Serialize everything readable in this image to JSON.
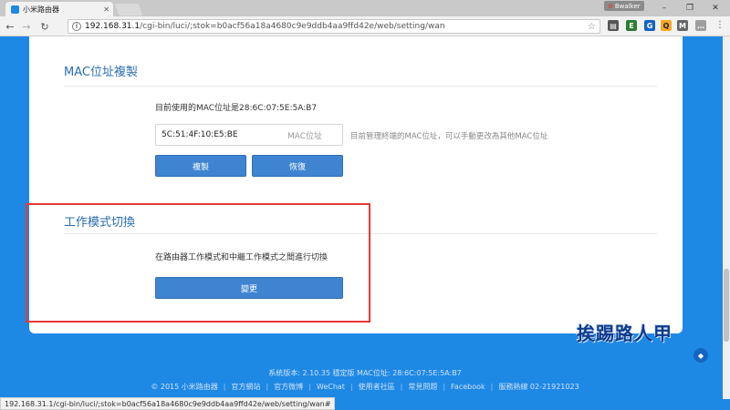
{
  "browser": {
    "tab_title": "小米路由器",
    "profile_badge": "Bwalker",
    "url_host": "192.168.31.1",
    "url_path": "/cgi-bin/luci/;stok=b0acf56a18a4680c9e9ddb4aa9ffd42e/web/setting/wan",
    "status_url": "192.168.31.1/cgi-bin/luci/;stok=b0acf56a18a4680c9e9ddb4aa9ffd42e/web/setting/wan#"
  },
  "mac_section": {
    "title": "MAC位址複製",
    "current_mac_text": "目前使用的MAC位址是28:6C:07:5E:5A:B7",
    "input_value": "5C:51:4F:10:E5:BE",
    "input_placeholder": "MAC位址",
    "hint": "目前管理終端的MAC位址，可以手動更改為其他MAC位址",
    "copy_button": "複製",
    "restore_button": "恢復"
  },
  "mode_section": {
    "title": "工作模式切換",
    "description": "在路由器工作模式和中繼工作模式之間進行切換",
    "change_button": "變更"
  },
  "footer": {
    "version_line": "系統版本: 2.10.35 穩定版  MAC位址: 28:6C:07:5E:5A:B7",
    "copyright": "© 2015 小米路由器",
    "links": [
      "官方網站",
      "官方微博",
      "WeChat",
      "使用者社區",
      "常見問題",
      "Facebook",
      "服務熱線 02-21921023"
    ]
  },
  "watermark": "挨踢路人甲",
  "colors": {
    "accent": "#1e88e5",
    "button": "#3f84d0",
    "highlight": "#e53935"
  }
}
